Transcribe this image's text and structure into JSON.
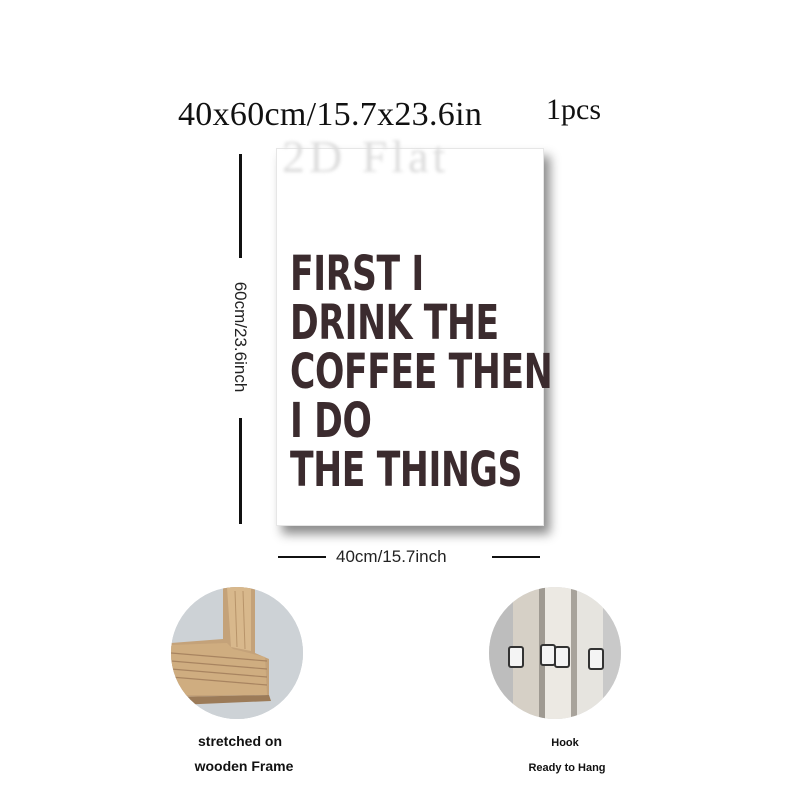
{
  "header": {
    "size_label": "40x60cm/15.7x23.6in",
    "quantity_label": "1pcs"
  },
  "watermark": {
    "text": "2D Flat"
  },
  "poster": {
    "lines": [
      "FIRST I",
      "DRINK THE",
      "COFFEE THEN",
      "I DO",
      "THE THINGS"
    ],
    "text_color": "#3b2b2e"
  },
  "dimensions": {
    "height_label": "60cm/23.6inch",
    "width_label": "40cm/15.7inch"
  },
  "features": [
    {
      "icon": "wooden-frame-photo",
      "caption_lines": [
        "stretched on",
        "wooden Frame"
      ]
    },
    {
      "icon": "hook-photo",
      "caption_lines": [
        "Hook",
        "Ready to Hang"
      ]
    }
  ]
}
